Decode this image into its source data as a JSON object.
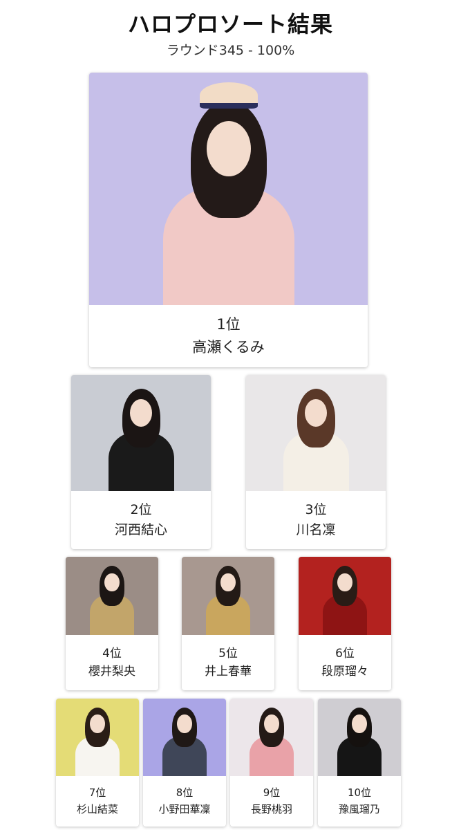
{
  "header": {
    "title": "ハロプロソート結果",
    "subtitle": "ラウンド345 - 100%"
  },
  "rankings": [
    {
      "rank": "1位",
      "name": "高瀬くるみ",
      "photo_alt": "高瀬くるみ",
      "bg": "#c6bfe9",
      "hair": "#231a18",
      "outfit": "#f1c9c6"
    },
    {
      "rank": "2位",
      "name": "河西結心",
      "photo_alt": "河西結心",
      "bg": "#c9ccd3",
      "hair": "#1b1514",
      "outfit": "#1a1a1a"
    },
    {
      "rank": "3位",
      "name": "川名凜",
      "photo_alt": "川名凜",
      "bg": "#e9e7e8",
      "hair": "#5a3828",
      "outfit": "#f4efe6"
    },
    {
      "rank": "4位",
      "name": "櫻井梨央",
      "photo_alt": "櫻井梨央",
      "bg": "#9b8d86",
      "hair": "#1c1614",
      "outfit": "#c2a56a"
    },
    {
      "rank": "5位",
      "name": "井上春華",
      "photo_alt": "井上春華",
      "bg": "#a89890",
      "hair": "#231a16",
      "outfit": "#c9a65e"
    },
    {
      "rank": "6位",
      "name": "段原瑠々",
      "photo_alt": "段原瑠々",
      "bg": "#b3221f",
      "hair": "#2a1c16",
      "outfit": "#8e1414"
    },
    {
      "rank": "7位",
      "name": "杉山結菜",
      "photo_alt": "杉山結菜",
      "bg": "#e4dc76",
      "hair": "#2a1d16",
      "outfit": "#f7f5f0"
    },
    {
      "rank": "8位",
      "name": "小野田華凜",
      "photo_alt": "小野田華凜",
      "bg": "#aaa5e6",
      "hair": "#1f1816",
      "outfit": "#3f4658"
    },
    {
      "rank": "9位",
      "name": "長野桃羽",
      "photo_alt": "長野桃羽",
      "bg": "#ece6ea",
      "hair": "#241a16",
      "outfit": "#e9a2a8"
    },
    {
      "rank": "10位",
      "name": "豫風瑠乃",
      "photo_alt": "豫風瑠乃",
      "bg": "#cfcdd2",
      "hair": "#15110f",
      "outfit": "#151515"
    }
  ]
}
